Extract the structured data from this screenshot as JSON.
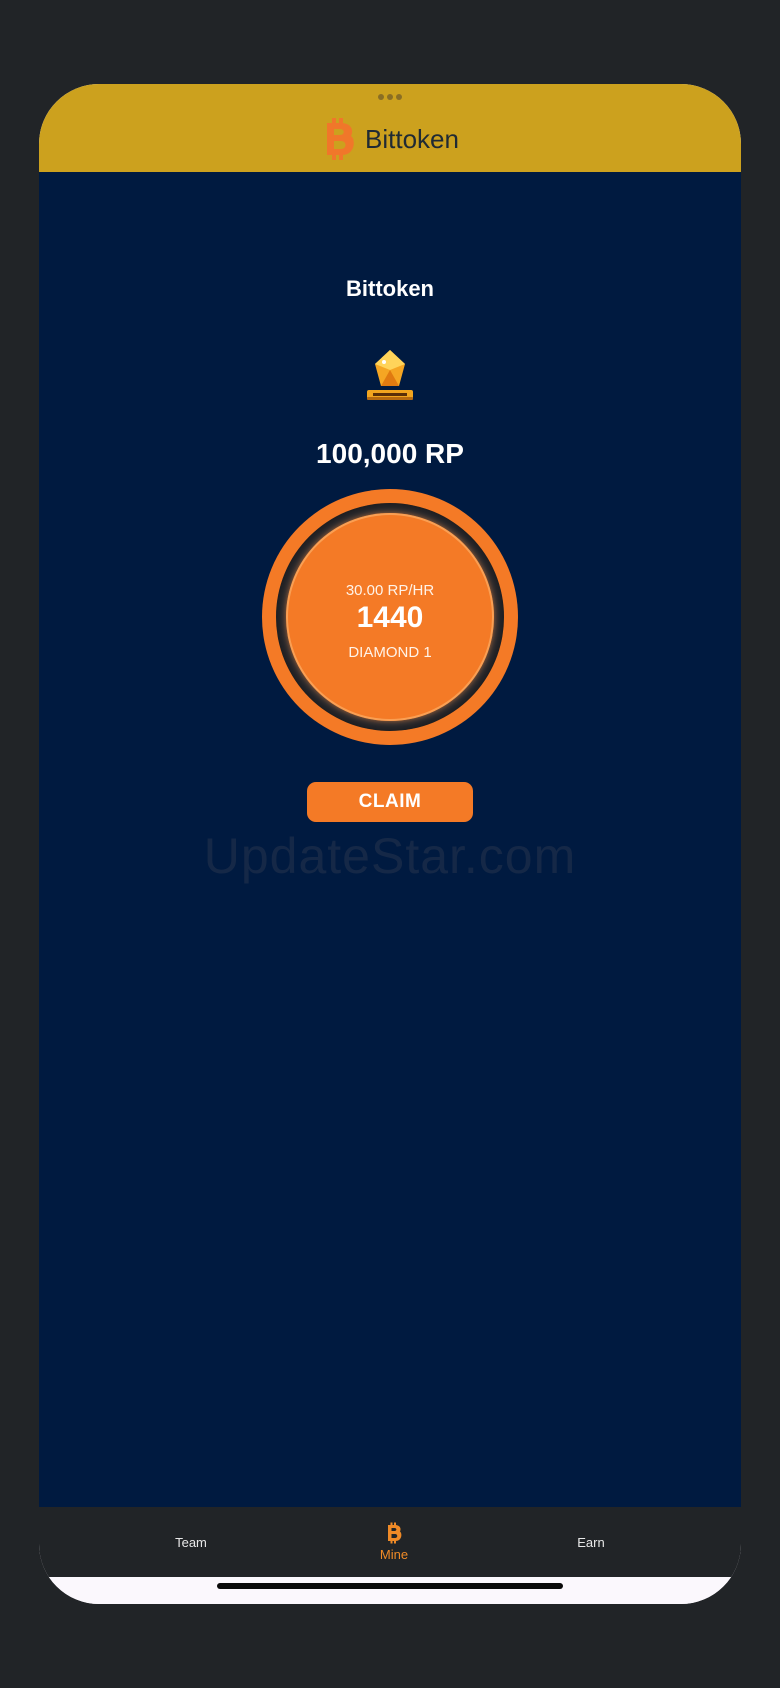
{
  "header": {
    "app_name": "Bittoken",
    "logo_icon": "bittoken-logo-icon"
  },
  "main": {
    "title": "Bittoken",
    "rank_badge": {
      "icon": "diamond-rank-badge-icon",
      "label": "DIAMOND 1"
    },
    "points": "100,000 RP",
    "dial": {
      "rate": "30.00 RP/HR",
      "count": "1440",
      "level": "DIAMOND 1"
    },
    "claim_label": "CLAIM",
    "watermark": "UpdateStar.com"
  },
  "tabbar": {
    "items": [
      {
        "label": "Team",
        "active": false
      },
      {
        "label": "Mine",
        "active": true,
        "icon": "bittoken-logo-icon"
      },
      {
        "label": "Earn",
        "active": false
      }
    ]
  },
  "colors": {
    "header_bg": "#cca11e",
    "content_bg": "#001a40",
    "accent": "#f47a26",
    "tabbar_bg": "#212427",
    "active_tab": "#ef8a27"
  }
}
